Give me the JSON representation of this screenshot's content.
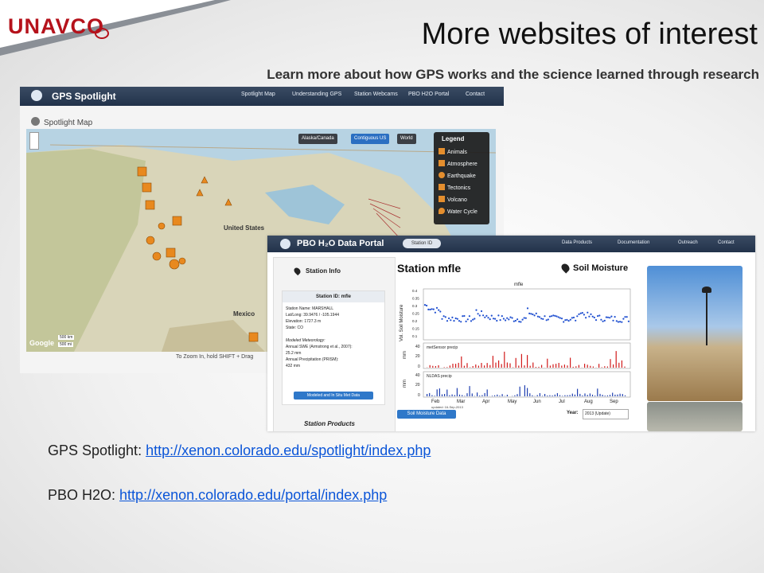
{
  "header": {
    "logo": "UNAVCO",
    "title": "More websites of interest",
    "subtitle": "Learn more about how GPS works and the science learned through research"
  },
  "spotlight": {
    "brand": "GPS Spotlight",
    "tabs": [
      "Spotlight Map",
      "Understanding GPS",
      "Station Webcams",
      "PBO H2O Portal",
      "Contact"
    ],
    "map_title": "Spotlight Map",
    "region_buttons": [
      "Alaska/Canada",
      "Contiguous US",
      "World"
    ],
    "legend_title": "Legend",
    "legend_items": [
      "Animals",
      "Atmosphere",
      "Earthquake",
      "Tectonics",
      "Volcano",
      "Water Cycle"
    ],
    "zoom_hint": "To Zoom In, hold SHIFT + Drag",
    "scale": [
      "500 km",
      "500 mi"
    ],
    "map_labels": [
      "United States",
      "Mexico"
    ],
    "map_attribution": "Google"
  },
  "portal": {
    "brand": "PBO H₂O Data Portal",
    "station_id_field": "Station ID",
    "tabs": [
      "Data Products",
      "Documentation",
      "Outreach",
      "Contact"
    ],
    "station_info": "Station Info",
    "box_title": "Station ID: mfle",
    "info_lines": [
      "Station Name: MARSHALL",
      "Lat/Long: 39.9476 / -105.1944",
      "Elevation: 1727.3 m",
      "State: CO",
      "Modeled Meteorology:",
      "Annual SWE (Armstrong et al., 2007):",
      "25.2 mm",
      "Annual Precipitation (PRISM):",
      "432 mm"
    ],
    "met_button": "Modeled and In Situ Met Data",
    "station_products": "Station Products",
    "station_title": "Station mfle",
    "soil_moisture": "Soil Moisture",
    "download_button": "Soil Moisture Data",
    "year_label": "Year:",
    "year_value": "2013 (Update)",
    "chart": {
      "title": "mfle",
      "ylabel_top": "Vol. Soil Moisture",
      "ylabel_mid": "mm",
      "ylabel_bot": "mm",
      "label_mid": "metSensor precip",
      "label_bot": "NLDAS precip",
      "months": [
        "Feb",
        "Mar",
        "Apr",
        "May",
        "Jun",
        "Jul",
        "Aug",
        "Sep"
      ],
      "updated": "updated: 16-Sep-2013",
      "top_ticks": [
        "0.4",
        "0.35",
        "0.3",
        "0.25",
        "0.2",
        "0.15",
        "0.1"
      ],
      "mid_ticks": [
        "40",
        "20",
        "0"
      ],
      "bot_ticks": [
        "40",
        "20",
        "0"
      ]
    }
  },
  "links": [
    {
      "label": "GPS Spotlight:",
      "url": "http://xenon.colorado.edu/spotlight/index.php"
    },
    {
      "label": "PBO H2O:",
      "url": "http://xenon.colorado.edu/portal/index.php"
    }
  ],
  "colors": {
    "brand_red": "#b5121b",
    "nav": "#22324a",
    "link": "#0b55d8",
    "accent_orange": "#e8891f"
  }
}
